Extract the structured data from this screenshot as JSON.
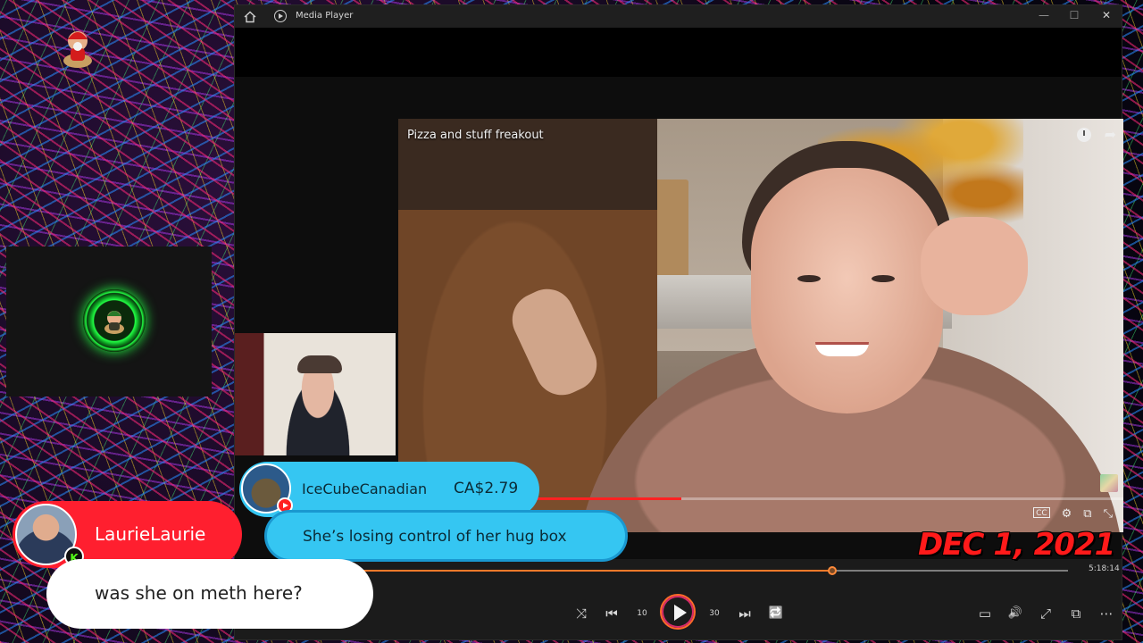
{
  "window": {
    "title": "Media Player",
    "minimize_label": "—",
    "maximize_label": "☐",
    "close_label": "✕"
  },
  "video": {
    "title": "Pizza and stuff freakout",
    "inner_progress": 0.39,
    "inner_controls": [
      "CC",
      "⚙",
      "⧉",
      "⤡"
    ]
  },
  "player": {
    "current_time": "5:18:14",
    "progress": 0.67
  },
  "controls": {
    "shuffle": "⤨",
    "previous": "⏮",
    "rewind_10": "10",
    "skip_30": "30",
    "next": "⏭",
    "repeat": "🔁",
    "captions": "▭",
    "volume": "🔊",
    "fullscreen": "⤢",
    "miniplayer": "⧉",
    "more": "⋯"
  },
  "overlay": {
    "date": "DEC 1, 2021"
  },
  "superchat": {
    "user": "IceCubeCanadian",
    "amount": "CA$2.79",
    "message": "She’s losing control of her hug box",
    "color": "#35c6f2"
  },
  "chat": {
    "user": "LaurieLaurie",
    "platform_badge": "K",
    "message": "was she on meth here?",
    "name_color": "#ff1f2f"
  }
}
